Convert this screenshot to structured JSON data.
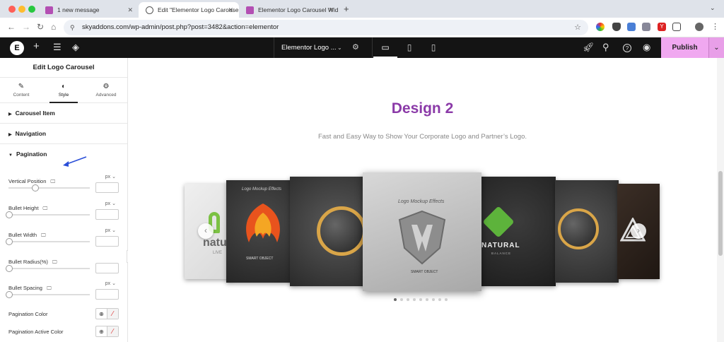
{
  "browser": {
    "tabs": [
      {
        "label": "1 new message",
        "active": false
      },
      {
        "label": "Edit \"Elementor Logo Carousel",
        "active": true
      },
      {
        "label": "Elementor Logo Carousel Wid",
        "active": false
      }
    ],
    "new_tab": "+",
    "url": "skyaddons.com/wp-admin/post.php?post=3482&action=elementor"
  },
  "toolbar": {
    "doc_title": "Elementor Logo ...",
    "publish_label": "Publish"
  },
  "panel": {
    "title": "Edit Logo Carousel",
    "tabs": [
      {
        "label": "Content",
        "icon": "pencil-icon"
      },
      {
        "label": "Style",
        "icon": "contrast-icon"
      },
      {
        "label": "Advanced",
        "icon": "gear-icon"
      }
    ],
    "sections": [
      {
        "label": "Carousel Item",
        "expanded": false
      },
      {
        "label": "Navigation",
        "expanded": false
      },
      {
        "label": "Pagination",
        "expanded": true
      }
    ],
    "controls": [
      {
        "label": "Vertical Position",
        "unit": "px",
        "value": "",
        "level": 0.33
      },
      {
        "label": "Bullet Height",
        "unit": "px",
        "value": "",
        "level": 0
      },
      {
        "label": "Bullet Width",
        "unit": "px",
        "value": "",
        "level": 0
      },
      {
        "label": "Bullet Radius(%)",
        "unit": "",
        "value": "",
        "level": 0
      },
      {
        "label": "Bullet Spacing",
        "unit": "px",
        "value": "",
        "level": 0
      }
    ],
    "colors": [
      {
        "label": "Pagination Color"
      },
      {
        "label": "Pagination Active Color"
      }
    ]
  },
  "canvas": {
    "heading": "Design 2",
    "subtitle": "Fast and Easy Way to Show Your Corporate Logo and Partner’s Logo.",
    "cards": [
      {
        "logo": "natu",
        "sub": "LIVE"
      },
      {
        "logo": "Logo Mockup Effects",
        "sub": "SMART OBJECT"
      },
      {
        "logo": "",
        "sub": ""
      },
      {
        "logo": "Logo Mockup Effects",
        "sub": "SMART OBJECT"
      },
      {
        "logo": "NATURAL",
        "sub": "BALANCE"
      },
      {
        "logo": "",
        "sub": ""
      },
      {
        "logo": "",
        "sub": ""
      }
    ],
    "pagination": {
      "total": 9,
      "active": 0
    },
    "prev_arrow": "‹",
    "next_arrow": "›"
  },
  "colors": {
    "accent": "#8b3aa8",
    "publish": "#f0a8f0",
    "topbar": "#141414"
  }
}
